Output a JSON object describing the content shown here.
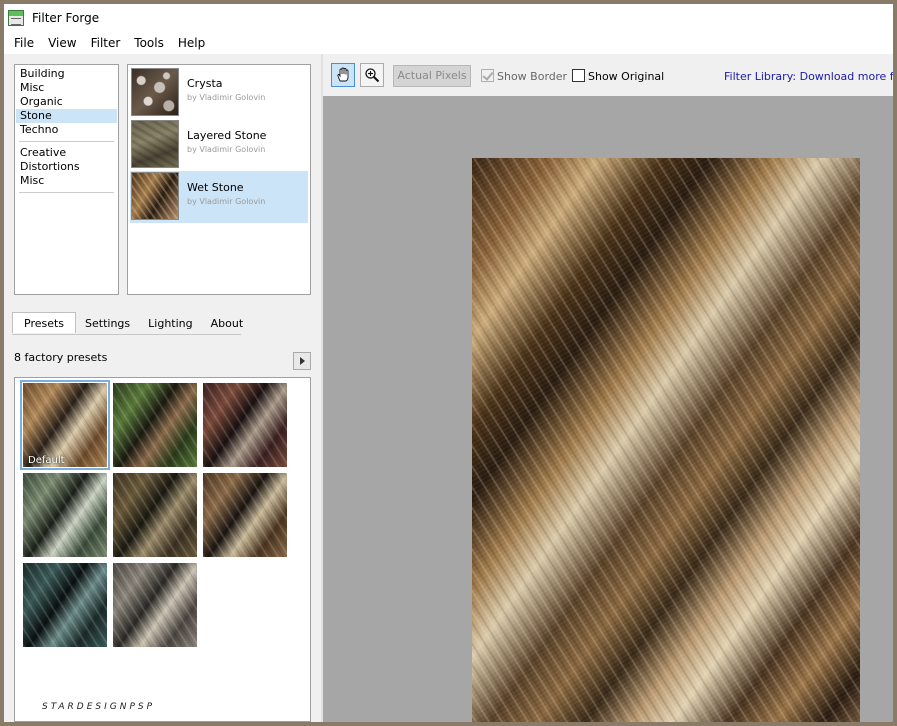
{
  "window": {
    "title": "Filter Forge"
  },
  "menu": [
    "File",
    "View",
    "Filter",
    "Tools",
    "Help"
  ],
  "categories": {
    "group1": [
      "Building",
      "Misc",
      "Organic",
      "Stone",
      "Techno"
    ],
    "group2": [
      "Creative",
      "Distortions",
      "Misc"
    ],
    "selected": "Stone"
  },
  "filters": [
    {
      "name": "Crysta",
      "author": "by Vladimir Golovin"
    },
    {
      "name": "Layered Stone",
      "author": "by Vladimir Golovin"
    },
    {
      "name": "Wet Stone",
      "author": "by Vladimir Golovin",
      "selected": true
    }
  ],
  "tabs": [
    "Presets",
    "Settings",
    "Lighting",
    "About"
  ],
  "active_tab": "Presets",
  "presets": {
    "header": "8 factory presets",
    "default_label": "Default",
    "items": [
      {
        "palette": [
          "#6b4a2a",
          "#b08858",
          "#2a2018",
          "#d8c8a8"
        ]
      },
      {
        "palette": [
          "#2a3a1a",
          "#5a7a3a",
          "#1a1a10",
          "#8a6a4a"
        ]
      },
      {
        "palette": [
          "#3a2020",
          "#7a4a3a",
          "#1a1010",
          "#a89888"
        ]
      },
      {
        "palette": [
          "#3a4a38",
          "#7a8a70",
          "#1a2018",
          "#c8d0c0"
        ]
      },
      {
        "palette": [
          "#3a3020",
          "#6a5a3a",
          "#1a1810",
          "#9a8a6a"
        ]
      },
      {
        "palette": [
          "#4a3420",
          "#8a6a48",
          "#1a1410",
          "#c8b898"
        ]
      },
      {
        "palette": [
          "#1a2a28",
          "#3a5a58",
          "#0a1010",
          "#6a8a88"
        ]
      },
      {
        "palette": [
          "#4a4440",
          "#8a847a",
          "#2a2824",
          "#c8c0b0"
        ]
      }
    ]
  },
  "toolbar": {
    "actual_pixels": "Actual Pixels",
    "show_border": "Show Border",
    "show_original": "Show Original",
    "library_link": "Filter Library: Download more filters"
  },
  "watermark": "STARDESIGNPSP",
  "colors": {
    "accent": "#cce4f7",
    "link": "#1a1aa8",
    "preview_bg": "#a6a6a6"
  }
}
